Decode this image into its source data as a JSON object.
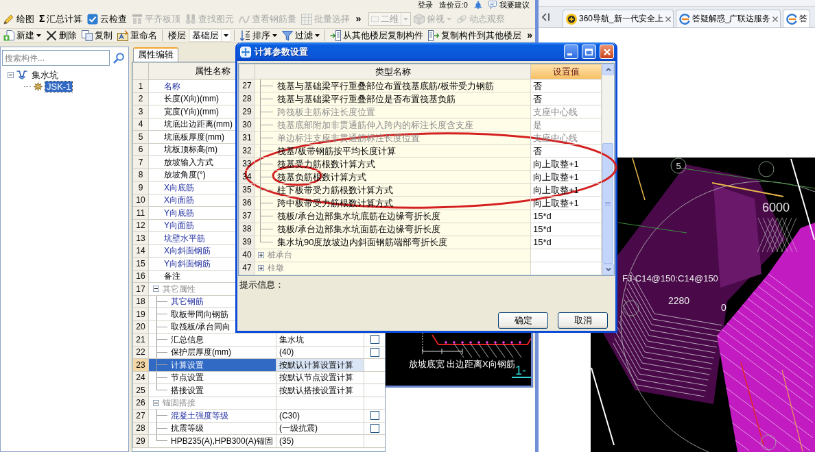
{
  "account_bar": {
    "login": "登录",
    "beans": "造价豆:0",
    "feedback": "我要建议"
  },
  "main_toolbar": {
    "buttons": [
      {
        "label": "绘图",
        "disabled": false
      },
      {
        "label": "汇总计算",
        "glyph": "Σ",
        "disabled": false
      },
      {
        "label": "云检查",
        "disabled": false
      },
      {
        "label": "平齐板顶",
        "disabled": true
      },
      {
        "label": "查找图元",
        "disabled": true
      },
      {
        "label": "查看钢筋量",
        "disabled": true
      },
      {
        "label": "批量选择",
        "disabled": true
      }
    ],
    "overflow": "»",
    "view_mode": {
      "value": "二维",
      "disabled": true
    },
    "view_buttons": [
      {
        "label": "俯视",
        "dropdown": true,
        "disabled": true
      },
      {
        "label": "动态观察",
        "dropdown": false,
        "disabled": true
      }
    ]
  },
  "component_toolbar": {
    "buttons": [
      {
        "label": "新建",
        "dropdown": true
      },
      {
        "label": "删除",
        "dropdown": false
      },
      {
        "label": "复制",
        "dropdown": false
      },
      {
        "label": "重命名",
        "dropdown": false
      }
    ],
    "floor": {
      "label": "楼层",
      "value": "基础层"
    },
    "tools": [
      {
        "label": "排序",
        "dropdown": true
      },
      {
        "label": "过滤",
        "dropdown": true
      },
      {
        "label": "从其他楼层复制构件",
        "dropdown": false
      },
      {
        "label": "复制构件到其他楼层",
        "dropdown": false
      }
    ],
    "overflow": "»"
  },
  "component_panel": {
    "search": {
      "placeholder": "搜索构件..."
    },
    "tree": [
      {
        "label": "集水坑",
        "expanded": true,
        "selected": false,
        "children": [
          {
            "label": "JSK-1",
            "selected": true
          }
        ]
      }
    ]
  },
  "property_panel": {
    "tabs": [
      {
        "label": "属性编辑",
        "selected": true
      }
    ],
    "columns": [
      "属性名称"
    ],
    "rows": [
      {
        "kind": "item",
        "number": "1",
        "label": "名称",
        "emphasis": true,
        "selected": false
      },
      {
        "kind": "item",
        "number": "2",
        "label": "长度(X向)(mm)",
        "emphasis": false,
        "selected": false
      },
      {
        "kind": "item",
        "number": "3",
        "label": "宽度(Y向)(mm)",
        "emphasis": false,
        "selected": false
      },
      {
        "kind": "item",
        "number": "4",
        "label": "坑底出边距离(mm)",
        "emphasis": false,
        "selected": false
      },
      {
        "kind": "item",
        "number": "5",
        "label": "坑底板厚度(mm)",
        "emphasis": false,
        "selected": false
      },
      {
        "kind": "item",
        "number": "6",
        "label": "坑板顶标高(m)",
        "emphasis": false,
        "selected": false
      },
      {
        "kind": "item",
        "number": "7",
        "label": "放坡输入方式",
        "emphasis": false,
        "selected": false
      },
      {
        "kind": "item",
        "number": "8",
        "label": "放坡角度(°)",
        "emphasis": false,
        "selected": false
      },
      {
        "kind": "item",
        "number": "9",
        "label": "X向底筋",
        "emphasis": true,
        "selected": false
      },
      {
        "kind": "item",
        "number": "10",
        "label": "X向面筋",
        "emphasis": true,
        "selected": false
      },
      {
        "kind": "item",
        "number": "11",
        "label": "Y向底筋",
        "emphasis": true,
        "selected": false
      },
      {
        "kind": "item",
        "number": "12",
        "label": "Y向面筋",
        "emphasis": true,
        "selected": false
      },
      {
        "kind": "item",
        "number": "13",
        "label": "坑壁水平筋",
        "emphasis": true,
        "selected": false
      },
      {
        "kind": "item",
        "number": "14",
        "label": "X向斜面钢筋",
        "emphasis": true,
        "selected": false
      },
      {
        "kind": "item",
        "number": "15",
        "label": "Y向斜面钢筋",
        "emphasis": true,
        "selected": false
      },
      {
        "kind": "item",
        "number": "16",
        "label": "备注",
        "emphasis": false,
        "selected": false
      },
      {
        "kind": "group",
        "number": "17",
        "label": "其它属性",
        "expanded": true,
        "selected": false,
        "children": [
          {
            "kind": "item",
            "number": "18",
            "label": "其它钢筋",
            "emphasis": true,
            "selected": false
          },
          {
            "kind": "item",
            "number": "19",
            "label": "取板带同向钢筋",
            "emphasis": false,
            "selected": false
          },
          {
            "kind": "item",
            "number": "20",
            "label": "取筏板/承台同向",
            "emphasis": false,
            "selected": false
          },
          {
            "kind": "item",
            "number": "21",
            "label": "汇总信息",
            "value": "集水坑",
            "checked": false,
            "emphasis": false,
            "selected": false
          },
          {
            "kind": "item",
            "number": "22",
            "label": "保护层厚度(mm)",
            "value": "(40)",
            "checked": false,
            "emphasis": false,
            "selected": false
          },
          {
            "kind": "item",
            "number": "23",
            "label": "计算设置",
            "value": "按默认计算设置计算",
            "emphasis": false,
            "selected": true
          },
          {
            "kind": "item",
            "number": "24",
            "label": "节点设置",
            "value": "按默认节点设置计算",
            "emphasis": false,
            "selected": false
          },
          {
            "kind": "item",
            "number": "25",
            "label": "搭接设置",
            "value": "按默认搭接设置计算",
            "emphasis": false,
            "selected": false
          }
        ]
      },
      {
        "kind": "group",
        "number": "26",
        "label": "锚固搭接",
        "expanded": true,
        "selected": false,
        "children": [
          {
            "kind": "item",
            "number": "27",
            "label": "混凝土强度等级",
            "value": "(C30)",
            "checked": false,
            "emphasis": true,
            "selected": false
          },
          {
            "kind": "item",
            "number": "28",
            "label": "抗震等级",
            "value": "(一级抗震)",
            "checked": false,
            "emphasis": false,
            "selected": false
          },
          {
            "kind": "item",
            "number": "29",
            "label": "HPB235(A),HPB300(A)锚固",
            "value": "(35)",
            "emphasis": false,
            "selected": false
          }
        ]
      }
    ]
  },
  "preview": {
    "labels": [
      "放坡底宽",
      "出边距离",
      "X向钢筋"
    ],
    "section_mark": "1-"
  },
  "dialog": {
    "title": "计算参数设置",
    "columns": [
      "类型名称",
      "设置值"
    ],
    "rows": [
      {
        "kind": "item",
        "number": "27",
        "label": "筏基与基础梁平行重叠部位布置筏基底筋/板带受力钢筋",
        "value": "否",
        "disabled": false
      },
      {
        "kind": "item",
        "number": "28",
        "label": "筏基与基础梁平行重叠部位是否布置筏基负筋",
        "value": "否",
        "disabled": false
      },
      {
        "kind": "item",
        "number": "29",
        "label": "跨筏板主筋标注长度位置",
        "value": "支座中心线",
        "disabled": true
      },
      {
        "kind": "item",
        "number": "30",
        "label": "筏基底部附加非贯通筋伸入跨内的标注长度含支座",
        "value": "是",
        "disabled": true
      },
      {
        "kind": "item",
        "number": "31",
        "label": "单边标注支座非贯通筋标注长度位置",
        "value": "支座中心线",
        "disabled": true
      },
      {
        "kind": "item",
        "number": "32",
        "label": "筏基/板带钢筋按平均长度计算",
        "value": "否",
        "disabled": false
      },
      {
        "kind": "item",
        "number": "33",
        "label": "筏基受力筋根数计算方式",
        "value": "向上取整+1",
        "disabled": false
      },
      {
        "kind": "item",
        "number": "34",
        "label": "筏基负筋根数计算方式",
        "value": "向上取整+1",
        "disabled": false
      },
      {
        "kind": "item",
        "number": "35",
        "label": "柱下板带受力筋根数计算方式",
        "value": "向上取整+1",
        "disabled": false
      },
      {
        "kind": "item",
        "number": "36",
        "label": "跨中板带受力筋根数计算方式",
        "value": "向上取整+1",
        "disabled": false
      },
      {
        "kind": "item",
        "number": "37",
        "label": "筏板/承台边部集水坑底筋在边缘弯折长度",
        "value": "15*d",
        "disabled": false
      },
      {
        "kind": "item",
        "number": "38",
        "label": "筏板/承台边部集水坑面筋在边缘弯折长度",
        "value": "15*d",
        "disabled": false
      },
      {
        "kind": "item",
        "number": "39",
        "label": "集水坑90度放坡边内斜面钢筋端部弯折长度",
        "value": "15*d",
        "disabled": false
      },
      {
        "kind": "group",
        "number": "40",
        "label": "桩承台",
        "expanded": false
      },
      {
        "kind": "group",
        "number": "47",
        "label": "柱墩",
        "expanded": false
      }
    ],
    "hint_label": "提示信息：",
    "buttons": [
      "确定",
      "取消"
    ]
  },
  "annotations": [
    {
      "kind": "ellipse"
    },
    {
      "kind": "ellipse"
    }
  ],
  "browser": {
    "tabs": [
      {
        "title": "360导航_新一代安全上",
        "selected": false,
        "closable": true
      },
      {
        "title": "答疑解惑_广联达服务",
        "selected": false,
        "closable": true
      },
      {
        "title": "答",
        "selected": true,
        "closable": false
      }
    ]
  },
  "cad_view": {
    "axis_number": "5",
    "dimension": "6000",
    "rebar_label": "FJ-C14@150:C14@150",
    "values": [
      "2280",
      "0"
    ]
  }
}
